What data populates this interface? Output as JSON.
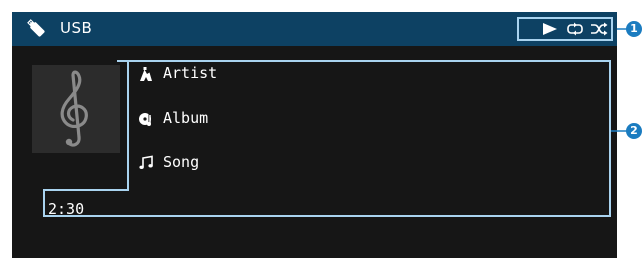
{
  "header": {
    "source_label": "USB",
    "source_icon": "usb-stick-icon",
    "controls": [
      {
        "name": "play-icon",
        "glyph": "▶"
      },
      {
        "name": "repeat-icon",
        "glyph": "repeat"
      },
      {
        "name": "shuffle-icon",
        "glyph": "shuffle"
      }
    ]
  },
  "album_art": {
    "icon": "treble-clef-icon"
  },
  "metadata": {
    "artist": "Artist",
    "album": "Album",
    "song": "Song"
  },
  "playback": {
    "elapsed_time": "2:30"
  },
  "callouts": {
    "one": "1",
    "two": "2"
  },
  "colors": {
    "background": "#161616",
    "header_bar": "#0d4163",
    "highlight_outline": "#a9d3ef",
    "callout_badge": "#1b7cc0",
    "text": "#ffffff"
  }
}
